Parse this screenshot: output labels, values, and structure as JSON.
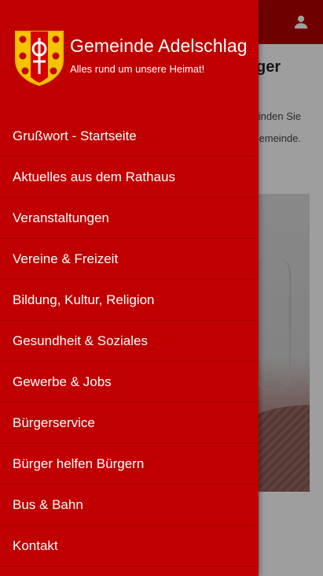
{
  "app": {
    "title": "Gemeinde Adelschlag",
    "subtitle": "Alles rund um unsere Heimat!",
    "accent_color": "#c00000",
    "topbar_color": "#b30000"
  },
  "topbar": {
    "user_icon": "user-icon"
  },
  "background_page": {
    "title_fragment": "ger",
    "text_lines": [
      "inden Sie",
      "Gemeinde."
    ]
  },
  "drawer": {
    "logo_icon": "coat-of-arms-icon",
    "items": [
      {
        "label": "Grußwort - Startseite"
      },
      {
        "label": "Aktuelles aus dem Rathaus"
      },
      {
        "label": "Veranstaltungen"
      },
      {
        "label": "Vereine & Freizeit"
      },
      {
        "label": "Bildung, Kultur, Religion"
      },
      {
        "label": "Gesundheit & Soziales"
      },
      {
        "label": "Gewerbe & Jobs"
      },
      {
        "label": "Bürgerservice"
      },
      {
        "label": "Bürger helfen Bürgern"
      },
      {
        "label": "Bus & Bahn"
      },
      {
        "label": "Kontakt"
      }
    ]
  }
}
